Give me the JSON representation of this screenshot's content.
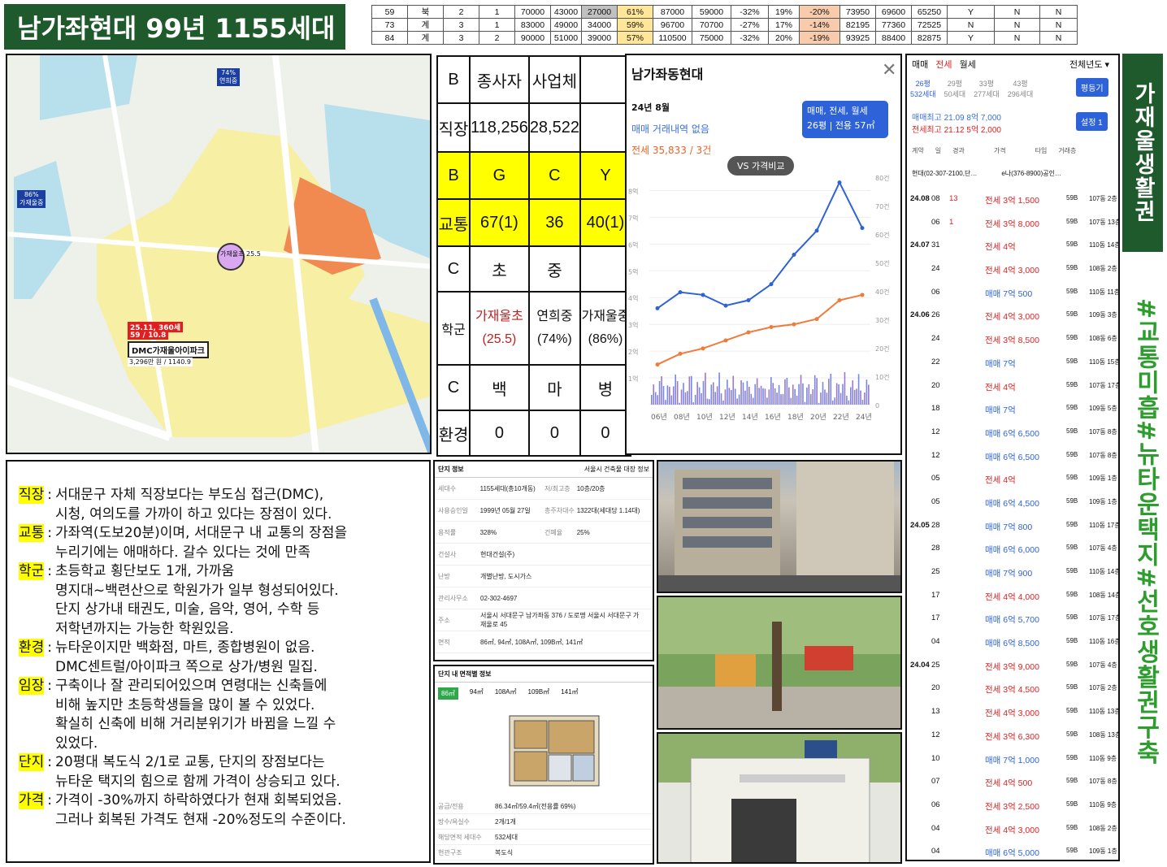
{
  "title": "남가좌현대 99년 1155세대",
  "top_table": [
    [
      "59",
      "북",
      "2",
      "1",
      "70000",
      "43000",
      "27000",
      "61%",
      "87000",
      "59000",
      "-32%",
      "19%",
      "-20%",
      "73950",
      "69600",
      "65250",
      "Y",
      "N",
      "N"
    ],
    [
      "73",
      "계",
      "3",
      "1",
      "83000",
      "49000",
      "34000",
      "59%",
      "96700",
      "70700",
      "-27%",
      "17%",
      "-14%",
      "82195",
      "77360",
      "72525",
      "N",
      "N",
      "N"
    ],
    [
      "84",
      "계",
      "3",
      "2",
      "90000",
      "51000",
      "39000",
      "57%",
      "110500",
      "75000",
      "-32%",
      "20%",
      "-19%",
      "93925",
      "88400",
      "82875",
      "Y",
      "N",
      "N"
    ]
  ],
  "map": {
    "labels": [
      "가재울초\n25.5",
      "DMC가재울아이파크",
      "25.11, 360세",
      "59 / 10.8",
      "74%\n연희중",
      "86%\n가재울중"
    ],
    "sub": "3,296만 원 / 1140.9"
  },
  "grid": {
    "rows": [
      [
        "B",
        "종사자",
        "사업체",
        ""
      ],
      [
        "직장",
        "118,256",
        "28,522",
        ""
      ],
      [
        "B",
        "G",
        "C",
        "Y"
      ],
      [
        "교통",
        "67(1)",
        "36",
        "40(1)"
      ],
      [
        "C",
        "초",
        "중",
        ""
      ],
      [
        "학군",
        "가재울초\n(25.5)",
        "연희중\n(74%)",
        "가재울중\n(86%)"
      ],
      [
        "C",
        "백",
        "마",
        "병"
      ],
      [
        "환경",
        "0",
        "0",
        "0"
      ]
    ]
  },
  "chart": {
    "header": "남가좌동현대",
    "date": "24년 8월",
    "sale": "매매 거래내역 없음",
    "jeonse": "전세 35,833 / 3건",
    "badge1": "매매, 전세, 월세",
    "badge2": "26평 | 전용 57㎡",
    "vs": "VS 가격비교",
    "y_left": [
      "8억",
      "7억",
      "6억",
      "5억",
      "4억",
      "3억",
      "2억",
      "1억"
    ],
    "y_right": [
      "80건",
      "70건",
      "60건",
      "50건",
      "40건",
      "30건",
      "20건",
      "10건",
      "0"
    ],
    "x": [
      "06년",
      "08년",
      "10년",
      "12년",
      "14년",
      "16년",
      "18년",
      "20년",
      "22년",
      "24년"
    ]
  },
  "chart_data": {
    "type": "line",
    "x": [
      "06년",
      "08년",
      "10년",
      "12년",
      "14년",
      "16년",
      "18년",
      "20년",
      "22년",
      "24년"
    ],
    "series": [
      {
        "name": "매매",
        "values": [
          3.6,
          4.2,
          4.1,
          3.7,
          3.9,
          4.5,
          5.6,
          6.5,
          8.3,
          6.6
        ]
      },
      {
        "name": "전세",
        "values": [
          1.5,
          1.9,
          2.1,
          2.4,
          2.7,
          2.9,
          3.0,
          3.2,
          3.9,
          4.1
        ]
      }
    ],
    "ylim": [
      0,
      8.5
    ]
  },
  "trades": {
    "tabs": [
      "매매",
      "전세",
      "월세"
    ],
    "period": "전체년도",
    "sizes": [
      [
        "26평",
        "532세대"
      ],
      [
        "29평",
        "50세대"
      ],
      [
        "33평",
        "277세대"
      ],
      [
        "43평",
        "296세대"
      ]
    ],
    "btn1": "평등기",
    "btn2": "설정 1",
    "max1": "매매최고 21.09 8억 7,000",
    "max2": "전세최고 21.12 5억 2,000",
    "cols": [
      "계약",
      "일",
      "경과",
      "가격",
      "타입",
      "거래층"
    ],
    "agent1": "현대(02-307-2100,단…",
    "agent2": "e나(376-8900)공인…",
    "rows": [
      [
        "24.08",
        "08",
        "13",
        "전세 3억 1,500",
        "59B",
        "107동 2층"
      ],
      [
        "",
        "06",
        "1",
        "전세 3억 8,000",
        "59B",
        "107동 13층"
      ],
      [
        "24.07",
        "31",
        "",
        "전세 4억",
        "59B",
        "110동 14층"
      ],
      [
        "",
        "24",
        "",
        "전세 4억 3,000",
        "59B",
        "108동 2층"
      ],
      [
        "",
        "06",
        "",
        "매매 7억 500",
        "59B",
        "110동 11층"
      ],
      [
        "24.06",
        "26",
        "",
        "전세 4억 3,000",
        "59B",
        "109동 3층"
      ],
      [
        "",
        "24",
        "",
        "전세 3억 8,500",
        "59B",
        "108동 6층"
      ],
      [
        "",
        "22",
        "",
        "매매 7억",
        "59B",
        "110동 15층"
      ],
      [
        "",
        "20",
        "",
        "전세 4억",
        "59B",
        "107동 17층"
      ],
      [
        "",
        "18",
        "",
        "매매 7억",
        "59B",
        "109동 5층"
      ],
      [
        "",
        "12",
        "",
        "매매 6억 6,500",
        "59B",
        "107동 8층"
      ],
      [
        "",
        "12",
        "",
        "매매 6억 6,500",
        "59B",
        "107동 8층"
      ],
      [
        "",
        "05",
        "",
        "전세 4억",
        "59B",
        "109동 1층"
      ],
      [
        "",
        "05",
        "",
        "매매 6억 4,500",
        "59B",
        "109동 1층"
      ],
      [
        "24.05",
        "28",
        "",
        "매매 7억 800",
        "59B",
        "110동 17층"
      ],
      [
        "",
        "28",
        "",
        "매매 6억 6,000",
        "59B",
        "107동 4층"
      ],
      [
        "",
        "25",
        "",
        "매매 7억 900",
        "59B",
        "110동 14층"
      ],
      [
        "",
        "17",
        "",
        "전세 4억 4,000",
        "59B",
        "108동 14층"
      ],
      [
        "",
        "17",
        "",
        "매매 6억 5,700",
        "59B",
        "107동 17층"
      ],
      [
        "",
        "04",
        "",
        "매매 6억 8,500",
        "59B",
        "110동 16층"
      ],
      [
        "24.04",
        "25",
        "",
        "전세 3억 9,000",
        "59B",
        "107동 4층"
      ],
      [
        "",
        "20",
        "",
        "전세 3억 4,500",
        "59B",
        "107동 2층"
      ],
      [
        "",
        "13",
        "",
        "전세 4억 3,000",
        "59B",
        "110동 13층"
      ],
      [
        "",
        "12",
        "",
        "전세 3억 6,300",
        "59B",
        "108동 13층"
      ],
      [
        "",
        "10",
        "",
        "매매 7억 1,000",
        "59B",
        "110동 9층"
      ],
      [
        "",
        "07",
        "",
        "전세 4억 500",
        "59B",
        "107동 8층"
      ],
      [
        "",
        "06",
        "",
        "전세 3억 2,500",
        "59B",
        "110동 9층"
      ],
      [
        "",
        "04",
        "",
        "전세 4억 3,000",
        "59B",
        "108동 2층"
      ],
      [
        "",
        "04",
        "",
        "매매 6억 5,000",
        "59B",
        "109동 1층"
      ]
    ]
  },
  "side1": "가재울생활권",
  "side2": "#교통미흡#뉴타운택지#선호생활권구축",
  "notes": [
    {
      "label": "직장",
      "lines": [
        "서대문구 자체 직장보다는 부도심 접근(DMC),",
        "시청, 여의도를 가까이 하고 있다는 장점이 있다."
      ]
    },
    {
      "label": "교통",
      "lines": [
        "가좌역(도보20분)이며, 서대문구 내 교통의 장점을",
        "누리기에는 애매하다. 갈수 있다는 것에 만족"
      ]
    },
    {
      "label": "학군",
      "lines": [
        "초등학교 횡단보도 1개, 가까움",
        "명지대~백련산으로 학원가가 일부 형성되어있다.",
        "단지 상가내 태권도, 미술, 음악, 영어, 수학 등",
        "저학년까지는 가능한 학원있음."
      ]
    },
    {
      "label": "환경",
      "lines": [
        "뉴타운이지만 백화점, 마트, 종합병원이 없음.",
        "DMC센트럴/아이파크 쪽으로 상가/병원 밀집."
      ]
    },
    {
      "label": "임장",
      "lines": [
        "구축이나 잘 관리되어있으며 연령대는 신축들에",
        "비해 높지만 초등학생들을 많이 볼 수 있었다.",
        "확실히 신축에 비해 거리분위기가 바뀜을 느낄 수",
        "있었다."
      ]
    },
    {
      "label": "단지",
      "lines": [
        "20평대 복도식 2/1로 교통, 단지의 장점보다는",
        "뉴타운 택지의 힘으로 함께 가격이 상승되고 있다."
      ]
    },
    {
      "label": "가격",
      "lines": [
        "가격이 -30%까지 하락하였다가 현재 회복되었음.",
        "그러나 회복된 가격도 현재 -20%정도의 수준이다."
      ]
    }
  ],
  "info": {
    "header": "단지 정보",
    "link": "서울시 건축물 대장 정보",
    "rows": [
      [
        "세대수",
        "1155세대(총10개동)",
        "저/최고층",
        "10층/20층"
      ],
      [
        "사용승인일",
        "1999년 05월 27일",
        "총주차대수",
        "1322대(세대당 1.14대)"
      ],
      [
        "용적률",
        "328%",
        "건폐율",
        "25%"
      ],
      [
        "건설사",
        "현대건설(주)",
        "",
        ""
      ],
      [
        "난방",
        "개별난방, 도시가스",
        "",
        ""
      ],
      [
        "관리사무소",
        "02-302-4697",
        "",
        ""
      ],
      [
        "주소",
        "서울시 서대문구 남가좌동 376 / 도로명 서울시 서대문구 가재울로 45",
        "",
        ""
      ],
      [
        "면적",
        "86㎡, 94㎡, 108A㎡, 109B㎡, 141㎡",
        "",
        ""
      ]
    ]
  },
  "floor": {
    "header": "단지 내 면적별 정보",
    "tabs": [
      "86㎡",
      "94㎡",
      "108A㎡",
      "109B㎡",
      "141㎡"
    ],
    "rows": [
      [
        "공급/전용",
        "86.34㎡/59.4㎡(전용률 69%)"
      ],
      [
        "방수/욕실수",
        "2개/1개"
      ],
      [
        "해당면적 세대수",
        "532세대"
      ],
      [
        "현관구조",
        "복도식"
      ]
    ]
  }
}
